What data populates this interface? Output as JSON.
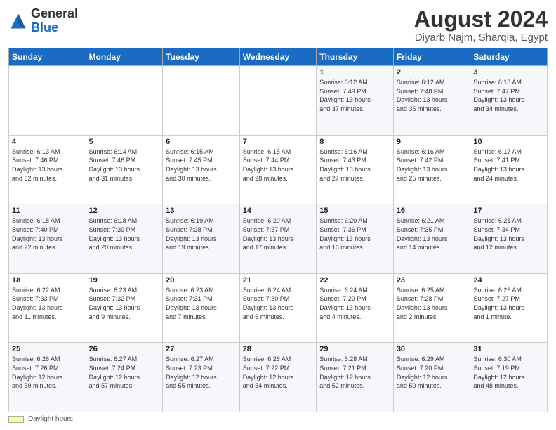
{
  "header": {
    "logo_general": "General",
    "logo_blue": "Blue",
    "month_title": "August 2024",
    "location": "Diyarb Najm, Sharqia, Egypt"
  },
  "weekdays": [
    "Sunday",
    "Monday",
    "Tuesday",
    "Wednesday",
    "Thursday",
    "Friday",
    "Saturday"
  ],
  "weeks": [
    [
      {
        "day": "",
        "info": ""
      },
      {
        "day": "",
        "info": ""
      },
      {
        "day": "",
        "info": ""
      },
      {
        "day": "",
        "info": ""
      },
      {
        "day": "1",
        "info": "Sunrise: 6:12 AM\nSunset: 7:49 PM\nDaylight: 13 hours\nand 37 minutes."
      },
      {
        "day": "2",
        "info": "Sunrise: 6:12 AM\nSunset: 7:48 PM\nDaylight: 13 hours\nand 35 minutes."
      },
      {
        "day": "3",
        "info": "Sunrise: 6:13 AM\nSunset: 7:47 PM\nDaylight: 13 hours\nand 34 minutes."
      }
    ],
    [
      {
        "day": "4",
        "info": "Sunrise: 6:13 AM\nSunset: 7:46 PM\nDaylight: 13 hours\nand 32 minutes."
      },
      {
        "day": "5",
        "info": "Sunrise: 6:14 AM\nSunset: 7:46 PM\nDaylight: 13 hours\nand 31 minutes."
      },
      {
        "day": "6",
        "info": "Sunrise: 6:15 AM\nSunset: 7:45 PM\nDaylight: 13 hours\nand 30 minutes."
      },
      {
        "day": "7",
        "info": "Sunrise: 6:15 AM\nSunset: 7:44 PM\nDaylight: 13 hours\nand 28 minutes."
      },
      {
        "day": "8",
        "info": "Sunrise: 6:16 AM\nSunset: 7:43 PM\nDaylight: 13 hours\nand 27 minutes."
      },
      {
        "day": "9",
        "info": "Sunrise: 6:16 AM\nSunset: 7:42 PM\nDaylight: 13 hours\nand 25 minutes."
      },
      {
        "day": "10",
        "info": "Sunrise: 6:17 AM\nSunset: 7:41 PM\nDaylight: 13 hours\nand 24 minutes."
      }
    ],
    [
      {
        "day": "11",
        "info": "Sunrise: 6:18 AM\nSunset: 7:40 PM\nDaylight: 13 hours\nand 22 minutes."
      },
      {
        "day": "12",
        "info": "Sunrise: 6:18 AM\nSunset: 7:39 PM\nDaylight: 13 hours\nand 20 minutes."
      },
      {
        "day": "13",
        "info": "Sunrise: 6:19 AM\nSunset: 7:38 PM\nDaylight: 13 hours\nand 19 minutes."
      },
      {
        "day": "14",
        "info": "Sunrise: 6:20 AM\nSunset: 7:37 PM\nDaylight: 13 hours\nand 17 minutes."
      },
      {
        "day": "15",
        "info": "Sunrise: 6:20 AM\nSunset: 7:36 PM\nDaylight: 13 hours\nand 16 minutes."
      },
      {
        "day": "16",
        "info": "Sunrise: 6:21 AM\nSunset: 7:35 PM\nDaylight: 13 hours\nand 14 minutes."
      },
      {
        "day": "17",
        "info": "Sunrise: 6:21 AM\nSunset: 7:34 PM\nDaylight: 13 hours\nand 12 minutes."
      }
    ],
    [
      {
        "day": "18",
        "info": "Sunrise: 6:22 AM\nSunset: 7:33 PM\nDaylight: 13 hours\nand 11 minutes."
      },
      {
        "day": "19",
        "info": "Sunrise: 6:23 AM\nSunset: 7:32 PM\nDaylight: 13 hours\nand 9 minutes."
      },
      {
        "day": "20",
        "info": "Sunrise: 6:23 AM\nSunset: 7:31 PM\nDaylight: 13 hours\nand 7 minutes."
      },
      {
        "day": "21",
        "info": "Sunrise: 6:24 AM\nSunset: 7:30 PM\nDaylight: 13 hours\nand 6 minutes."
      },
      {
        "day": "22",
        "info": "Sunrise: 6:24 AM\nSunset: 7:29 PM\nDaylight: 13 hours\nand 4 minutes."
      },
      {
        "day": "23",
        "info": "Sunrise: 6:25 AM\nSunset: 7:28 PM\nDaylight: 13 hours\nand 2 minutes."
      },
      {
        "day": "24",
        "info": "Sunrise: 6:26 AM\nSunset: 7:27 PM\nDaylight: 13 hours\nand 1 minute."
      }
    ],
    [
      {
        "day": "25",
        "info": "Sunrise: 6:26 AM\nSunset: 7:26 PM\nDaylight: 12 hours\nand 59 minutes."
      },
      {
        "day": "26",
        "info": "Sunrise: 6:27 AM\nSunset: 7:24 PM\nDaylight: 12 hours\nand 57 minutes."
      },
      {
        "day": "27",
        "info": "Sunrise: 6:27 AM\nSunset: 7:23 PM\nDaylight: 12 hours\nand 55 minutes."
      },
      {
        "day": "28",
        "info": "Sunrise: 6:28 AM\nSunset: 7:22 PM\nDaylight: 12 hours\nand 54 minutes."
      },
      {
        "day": "29",
        "info": "Sunrise: 6:28 AM\nSunset: 7:21 PM\nDaylight: 12 hours\nand 52 minutes."
      },
      {
        "day": "30",
        "info": "Sunrise: 6:29 AM\nSunset: 7:20 PM\nDaylight: 12 hours\nand 50 minutes."
      },
      {
        "day": "31",
        "info": "Sunrise: 6:30 AM\nSunset: 7:19 PM\nDaylight: 12 hours\nand 48 minutes."
      }
    ]
  ],
  "footer": {
    "swatch_label": "Daylight hours"
  }
}
